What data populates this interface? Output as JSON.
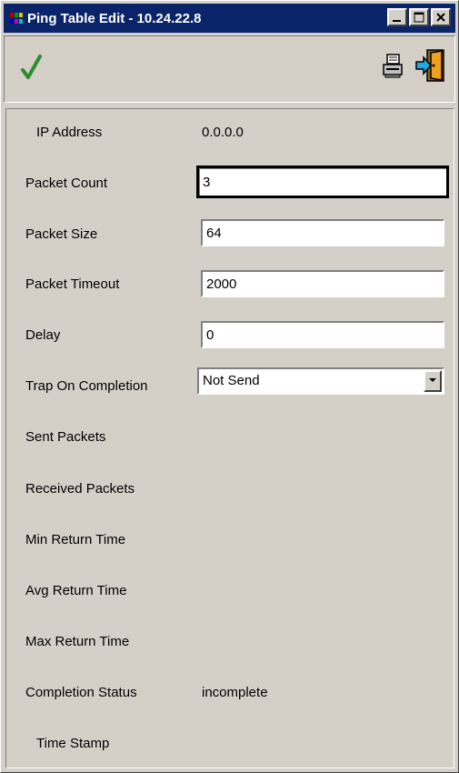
{
  "window": {
    "title": "Ping Table Edit - 10.24.22.8"
  },
  "toolbar": {
    "ok_icon": "checkmark-icon",
    "print_icon": "printer-icon",
    "exit_icon": "exit-door-icon",
    "ok_color": "#2e8b2e"
  },
  "form": {
    "ip_address": {
      "label": "IP Address",
      "value": "0.0.0.0"
    },
    "packet_count": {
      "label": "Packet Count",
      "value": "3"
    },
    "packet_size": {
      "label": "Packet Size",
      "value": "64"
    },
    "packet_timeout": {
      "label": "Packet Timeout",
      "value": "2000"
    },
    "delay": {
      "label": "Delay",
      "value": "0"
    },
    "trap_on_completion": {
      "label": "Trap On Completion",
      "value": "Not Send"
    },
    "sent_packets": {
      "label": "Sent Packets",
      "value": ""
    },
    "received_packets": {
      "label": "Received Packets",
      "value": ""
    },
    "min_return_time": {
      "label": "Min Return Time",
      "value": ""
    },
    "avg_return_time": {
      "label": "Avg Return Time",
      "value": ""
    },
    "max_return_time": {
      "label": "Max Return Time",
      "value": ""
    },
    "completion_status": {
      "label": "Completion Status",
      "value": "incomplete"
    },
    "time_stamp": {
      "label": "Time Stamp",
      "value": ""
    }
  }
}
